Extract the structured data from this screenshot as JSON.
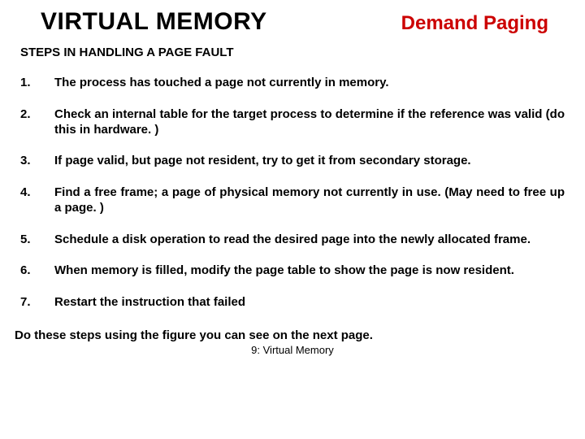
{
  "header": {
    "title_left": "VIRTUAL MEMORY",
    "title_right": "Demand Paging"
  },
  "subtitle": "STEPS IN HANDLING A PAGE FAULT",
  "steps": [
    {
      "n": "1.",
      "text": "The process has touched a page not currently in memory."
    },
    {
      "n": "2.",
      "text": "Check an internal table for the target process to determine if the reference was valid (do this in hardware. )"
    },
    {
      "n": "3.",
      "text": "If page valid, but page not resident, try to get it from secondary storage."
    },
    {
      "n": "4.",
      "text": "Find a free frame; a page of physical memory not currently in use. (May need to free up a page. )"
    },
    {
      "n": "5.",
      "text": "Schedule a disk operation to read the desired page into the newly allocated frame."
    },
    {
      "n": "6.",
      "text": "When memory is filled, modify the page table to show the page is now resident."
    },
    {
      "n": "7.",
      "text": "Restart the instruction that failed"
    }
  ],
  "footer_note": "Do these steps using the figure you can see on the next page.",
  "slide_ref": "9: Virtual Memory"
}
